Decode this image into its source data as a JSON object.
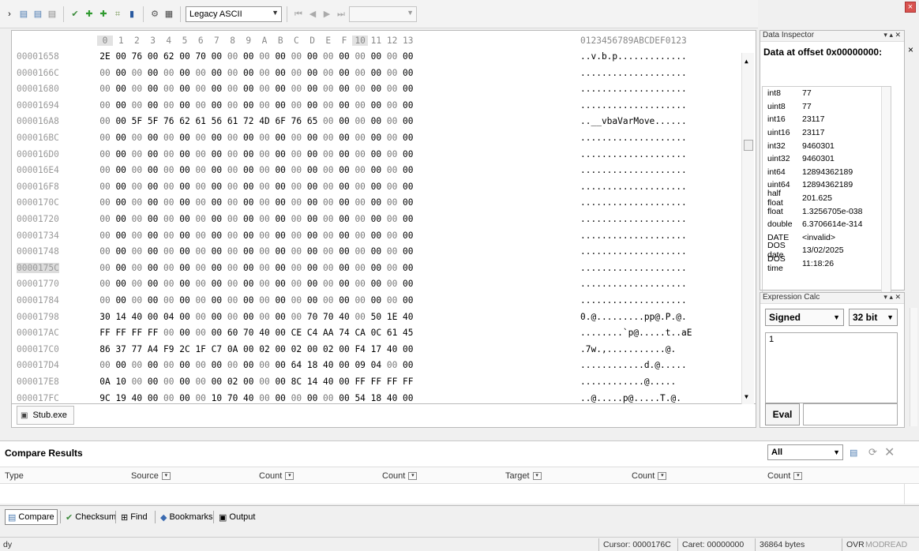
{
  "toolbar": {
    "encoding_select": "Legacy ASCII",
    "icons": [
      "copy-icon",
      "copy-hex-icon",
      "copy-text-icon",
      "checksum-icon",
      "compare-icon",
      "compare-next-icon",
      "structure-icon",
      "chart-icon",
      "settings-icon",
      "calculator-icon",
      "first-icon",
      "prev-icon",
      "next-icon",
      "last-icon"
    ]
  },
  "hex": {
    "columns": [
      "0",
      "1",
      "2",
      "3",
      "4",
      "5",
      "6",
      "7",
      "8",
      "9",
      "A",
      "B",
      "C",
      "D",
      "E",
      "F",
      "10",
      "11",
      "12",
      "13"
    ],
    "ascii_header": "0123456789ABCDEF0123",
    "rows": [
      {
        "offset": "00001658",
        "bytes": [
          "2E",
          "00",
          "76",
          "00",
          "62",
          "00",
          "70",
          "00",
          "00",
          "00",
          "00",
          "00",
          "00",
          "00",
          "00",
          "00",
          "00",
          "00",
          "00",
          "00"
        ],
        "ascii": "..v.b.p............."
      },
      {
        "offset": "0000166C",
        "bytes": [
          "00",
          "00",
          "00",
          "00",
          "00",
          "00",
          "00",
          "00",
          "00",
          "00",
          "00",
          "00",
          "00",
          "00",
          "00",
          "00",
          "00",
          "00",
          "00",
          "00"
        ],
        "ascii": "...................."
      },
      {
        "offset": "00001680",
        "bytes": [
          "00",
          "00",
          "00",
          "00",
          "00",
          "00",
          "00",
          "00",
          "00",
          "00",
          "00",
          "00",
          "00",
          "00",
          "00",
          "00",
          "00",
          "00",
          "00",
          "00"
        ],
        "ascii": "...................."
      },
      {
        "offset": "00001694",
        "bytes": [
          "00",
          "00",
          "00",
          "00",
          "00",
          "00",
          "00",
          "00",
          "00",
          "00",
          "00",
          "00",
          "00",
          "00",
          "00",
          "00",
          "00",
          "00",
          "00",
          "00"
        ],
        "ascii": "...................."
      },
      {
        "offset": "000016A8",
        "bytes": [
          "00",
          "00",
          "5F",
          "5F",
          "76",
          "62",
          "61",
          "56",
          "61",
          "72",
          "4D",
          "6F",
          "76",
          "65",
          "00",
          "00",
          "00",
          "00",
          "00",
          "00"
        ],
        "ascii": "..__vbaVarMove......"
      },
      {
        "offset": "000016BC",
        "bytes": [
          "00",
          "00",
          "00",
          "00",
          "00",
          "00",
          "00",
          "00",
          "00",
          "00",
          "00",
          "00",
          "00",
          "00",
          "00",
          "00",
          "00",
          "00",
          "00",
          "00"
        ],
        "ascii": "...................."
      },
      {
        "offset": "000016D0",
        "bytes": [
          "00",
          "00",
          "00",
          "00",
          "00",
          "00",
          "00",
          "00",
          "00",
          "00",
          "00",
          "00",
          "00",
          "00",
          "00",
          "00",
          "00",
          "00",
          "00",
          "00"
        ],
        "ascii": "...................."
      },
      {
        "offset": "000016E4",
        "bytes": [
          "00",
          "00",
          "00",
          "00",
          "00",
          "00",
          "00",
          "00",
          "00",
          "00",
          "00",
          "00",
          "00",
          "00",
          "00",
          "00",
          "00",
          "00",
          "00",
          "00"
        ],
        "ascii": "...................."
      },
      {
        "offset": "000016F8",
        "bytes": [
          "00",
          "00",
          "00",
          "00",
          "00",
          "00",
          "00",
          "00",
          "00",
          "00",
          "00",
          "00",
          "00",
          "00",
          "00",
          "00",
          "00",
          "00",
          "00",
          "00"
        ],
        "ascii": "...................."
      },
      {
        "offset": "0000170C",
        "bytes": [
          "00",
          "00",
          "00",
          "00",
          "00",
          "00",
          "00",
          "00",
          "00",
          "00",
          "00",
          "00",
          "00",
          "00",
          "00",
          "00",
          "00",
          "00",
          "00",
          "00"
        ],
        "ascii": "...................."
      },
      {
        "offset": "00001720",
        "bytes": [
          "00",
          "00",
          "00",
          "00",
          "00",
          "00",
          "00",
          "00",
          "00",
          "00",
          "00",
          "00",
          "00",
          "00",
          "00",
          "00",
          "00",
          "00",
          "00",
          "00"
        ],
        "ascii": "...................."
      },
      {
        "offset": "00001734",
        "bytes": [
          "00",
          "00",
          "00",
          "00",
          "00",
          "00",
          "00",
          "00",
          "00",
          "00",
          "00",
          "00",
          "00",
          "00",
          "00",
          "00",
          "00",
          "00",
          "00",
          "00"
        ],
        "ascii": "...................."
      },
      {
        "offset": "00001748",
        "bytes": [
          "00",
          "00",
          "00",
          "00",
          "00",
          "00",
          "00",
          "00",
          "00",
          "00",
          "00",
          "00",
          "00",
          "00",
          "00",
          "00",
          "00",
          "00",
          "00",
          "00"
        ],
        "ascii": "...................."
      },
      {
        "offset": "0000175C",
        "bytes": [
          "00",
          "00",
          "00",
          "00",
          "00",
          "00",
          "00",
          "00",
          "00",
          "00",
          "00",
          "00",
          "00",
          "00",
          "00",
          "00",
          "00",
          "00",
          "00",
          "00"
        ],
        "ascii": "...................."
      },
      {
        "offset": "00001770",
        "bytes": [
          "00",
          "00",
          "00",
          "00",
          "00",
          "00",
          "00",
          "00",
          "00",
          "00",
          "00",
          "00",
          "00",
          "00",
          "00",
          "00",
          "00",
          "00",
          "00",
          "00"
        ],
        "ascii": "...................."
      },
      {
        "offset": "00001784",
        "bytes": [
          "00",
          "00",
          "00",
          "00",
          "00",
          "00",
          "00",
          "00",
          "00",
          "00",
          "00",
          "00",
          "00",
          "00",
          "00",
          "00",
          "00",
          "00",
          "00",
          "00"
        ],
        "ascii": "...................."
      },
      {
        "offset": "00001798",
        "bytes": [
          "30",
          "14",
          "40",
          "00",
          "04",
          "00",
          "00",
          "00",
          "00",
          "00",
          "00",
          "00",
          "00",
          "70",
          "70",
          "40",
          "00",
          "50",
          "1E",
          "40",
          "00"
        ],
        "ascii": "0.@.........pp@.P.@."
      },
      {
        "offset": "000017AC",
        "bytes": [
          "FF",
          "FF",
          "FF",
          "FF",
          "00",
          "00",
          "00",
          "00",
          "60",
          "70",
          "40",
          "00",
          "CE",
          "C4",
          "AA",
          "74",
          "CA",
          "0C",
          "61",
          "45"
        ],
        "ascii": "........`p@.....t..aE"
      },
      {
        "offset": "000017C0",
        "bytes": [
          "86",
          "37",
          "77",
          "A4",
          "F9",
          "2C",
          "1F",
          "C7",
          "0A",
          "00",
          "02",
          "00",
          "02",
          "00",
          "02",
          "00",
          "F4",
          "17",
          "40",
          "00"
        ],
        "ascii": ".7w.,...........@."
      },
      {
        "offset": "000017D4",
        "bytes": [
          "00",
          "00",
          "00",
          "00",
          "00",
          "00",
          "00",
          "00",
          "00",
          "00",
          "00",
          "00",
          "64",
          "18",
          "40",
          "00",
          "09",
          "04",
          "00",
          "00"
        ],
        "ascii": "............d.@....."
      },
      {
        "offset": "000017E8",
        "bytes": [
          "0A",
          "10",
          "00",
          "00",
          "00",
          "00",
          "00",
          "00",
          "02",
          "00",
          "00",
          "00",
          "8C",
          "14",
          "40",
          "00",
          "FF",
          "FF",
          "FF",
          "FF"
        ],
        "ascii": "............@....."
      },
      {
        "offset": "000017FC",
        "bytes": [
          "9C",
          "19",
          "40",
          "00",
          "00",
          "00",
          "00",
          "10",
          "70",
          "40",
          "00",
          "00",
          "00",
          "00",
          "00",
          "00",
          "54",
          "18",
          "40",
          "00"
        ],
        "ascii": "..@.....p@.....T.@."
      }
    ]
  },
  "file_tab": "Stub.exe",
  "inspector": {
    "title": "Data Inspector",
    "heading": "Data at offset 0x00000000:",
    "rows": [
      {
        "k": "int8",
        "v": "77"
      },
      {
        "k": "uint8",
        "v": "77"
      },
      {
        "k": "int16",
        "v": "23117"
      },
      {
        "k": "uint16",
        "v": "23117"
      },
      {
        "k": "int32",
        "v": "9460301"
      },
      {
        "k": "uint32",
        "v": "9460301"
      },
      {
        "k": "int64",
        "v": "12894362189"
      },
      {
        "k": "uint64",
        "v": "12894362189"
      },
      {
        "k": "half float",
        "v": "201.625"
      },
      {
        "k": "float",
        "v": "1.3256705e-038"
      },
      {
        "k": "double",
        "v": "6.3706614e-314"
      },
      {
        "k": "DATE",
        "v": "<invalid>"
      },
      {
        "k": "DOS date",
        "v": "13/02/2025"
      },
      {
        "k": "DOS time",
        "v": "11:18:26"
      }
    ]
  },
  "calc": {
    "title": "Expression Calc",
    "sign": "Signed",
    "width": "32 bit",
    "input": "1",
    "eval": "Eval"
  },
  "compare": {
    "title": "Compare Results",
    "filter": "All",
    "columns": [
      "Type",
      "Source",
      "Count",
      "Count",
      "Target",
      "Count",
      "Count"
    ]
  },
  "tabs": [
    "Compare",
    "Checksum",
    "Find",
    "Bookmarks",
    "Output"
  ],
  "status": {
    "left": "dy",
    "cursor": "Cursor: 0000176C",
    "caret": "Caret: 00000000",
    "size": "36864 bytes",
    "ovr": "OVR",
    "mod": "MOD",
    "read": "READ"
  }
}
